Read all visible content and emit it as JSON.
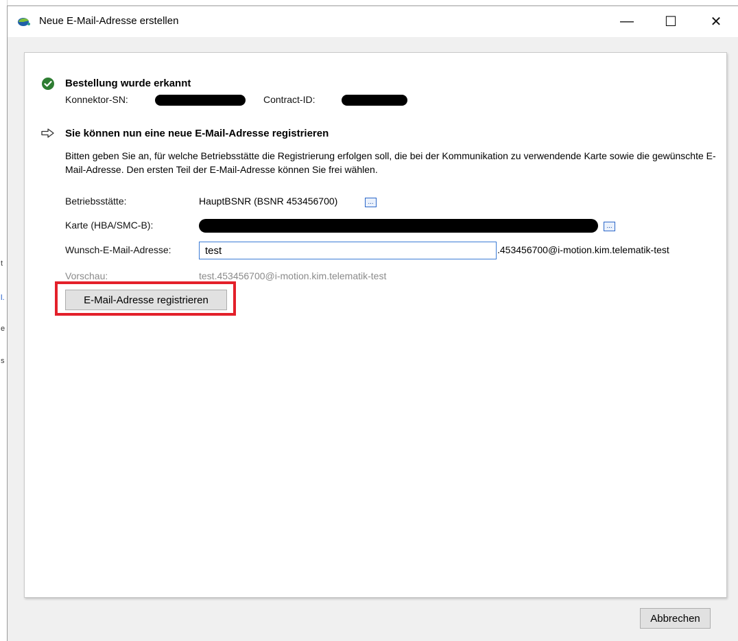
{
  "window": {
    "title": "Neue E-Mail-Adresse erstellen",
    "minimize": "—",
    "maximize": "☐",
    "close": "✕"
  },
  "status": {
    "heading": "Bestellung wurde erkannt",
    "connector_sn_label": "Konnektor-SN:",
    "contract_id_label": "Contract-ID:"
  },
  "register": {
    "heading": "Sie können nun eine neue E-Mail-Adresse registrieren",
    "description": "Bitten geben Sie an, für welche Betriebsstätte die Registrierung erfolgen soll, die bei der Kommunikation zu verwendende Karte sowie die gewünschte E-Mail-Adresse. Den ersten Teil der E-Mail-Adresse können Sie frei wählen."
  },
  "form": {
    "site_label": "Betriebsstätte:",
    "site_value": "HauptBSNR (BSNR 453456700)",
    "card_label": "Karte (HBA/SMC-B):",
    "email_label": "Wunsch-E-Mail-Adresse:",
    "email_value": "test",
    "email_suffix": ".453456700@i-motion.kim.telematik-test",
    "preview_label": "Vorschau:",
    "preview_value": "test.453456700@i-motion.kim.telematik-test",
    "dots": "..."
  },
  "buttons": {
    "register": "E-Mail-Adresse registrieren",
    "cancel": "Abbrechen"
  },
  "colors": {
    "highlight": "#e3202a",
    "check": "#2e7d32",
    "accent": "#3a7bd5"
  },
  "background_fragments": [
    "t",
    "l.",
    "e",
    "s"
  ]
}
